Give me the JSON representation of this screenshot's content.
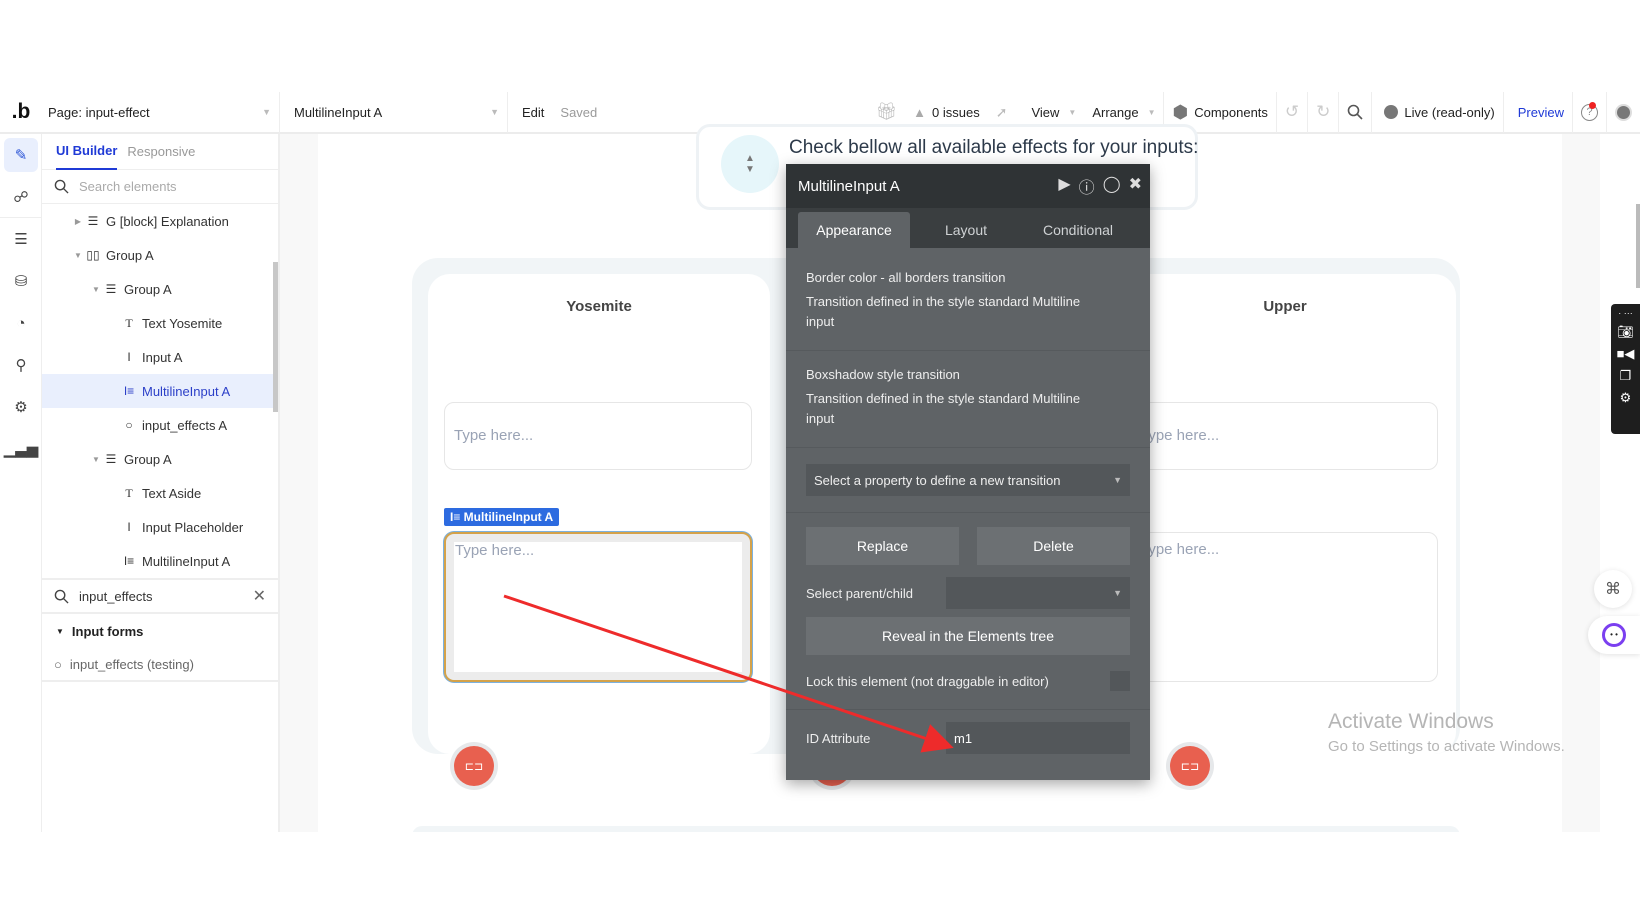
{
  "topbar": {
    "logo": ".b",
    "page_select": "Page: input-effect",
    "element_select": "MultilineInput A",
    "edit": "Edit",
    "saved": "Saved",
    "issues": "0 issues",
    "view": "View",
    "arrange": "Arrange",
    "components": "Components",
    "live": "Live (read-only)",
    "preview": "Preview"
  },
  "panel": {
    "tabs": [
      "UI Builder",
      "Responsive"
    ],
    "search_placeholder": "Search elements",
    "tree": [
      {
        "label": "G [block] Explanation",
        "icon": "group-icon"
      },
      {
        "label": "Group A",
        "icon": "column-group-icon"
      },
      {
        "label": "Group A",
        "icon": "group-icon"
      },
      {
        "label": "Text Yosemite",
        "icon": "text-icon"
      },
      {
        "label": "Input A",
        "icon": "input-icon"
      },
      {
        "label": "MultilineInput A",
        "icon": "multiline-input-icon",
        "selected": true
      },
      {
        "label": "input_effects A",
        "icon": "reusable-icon"
      },
      {
        "label": "Group A",
        "icon": "group-icon"
      },
      {
        "label": "Text Aside",
        "icon": "text-icon"
      },
      {
        "label": "Input Placeholder",
        "icon": "input-icon"
      },
      {
        "label": "MultilineInput A",
        "icon": "multiline-input-icon"
      }
    ],
    "search2_value": "input_effects",
    "group_label": "Input forms",
    "group_item": "input_effects (testing)"
  },
  "canvas": {
    "header_text": "Check bellow all available effects for your inputs:",
    "cards": [
      {
        "title": "Yosemite",
        "input_placeholder": "Type here...",
        "multiline_placeholder": "Type here..."
      },
      {
        "title": "Upper",
        "input_placeholder": "Type here...",
        "multiline_placeholder": "Type here..."
      }
    ],
    "selection_tag": "MultilineInput A"
  },
  "editor": {
    "title": "MultilineInput A",
    "tabs": [
      "Appearance",
      "Layout",
      "Conditional"
    ],
    "transitions": [
      {
        "title": "Border color - all borders transition",
        "desc": "Transition defined in the style standard Multiline input"
      },
      {
        "title": "Boxshadow style transition",
        "desc": "Transition defined in the style standard Multiline input"
      }
    ],
    "new_transition_placeholder": "Select a property to define a new transition",
    "replace": "Replace",
    "delete": "Delete",
    "parent_child_label": "Select parent/child",
    "reveal": "Reveal in the Elements tree",
    "lock_label": "Lock this element (not draggable in editor)",
    "lock_checked": false,
    "id_label": "ID Attribute",
    "id_value": "m1"
  },
  "watermark": {
    "line1": "Activate Windows",
    "line2": "Go to Settings to activate Windows."
  },
  "colors": {
    "accent": "#1f3ad6",
    "selection": "#2d6be0",
    "fab": "#e8604f",
    "annotation_arrow": "#ee2b2b"
  }
}
